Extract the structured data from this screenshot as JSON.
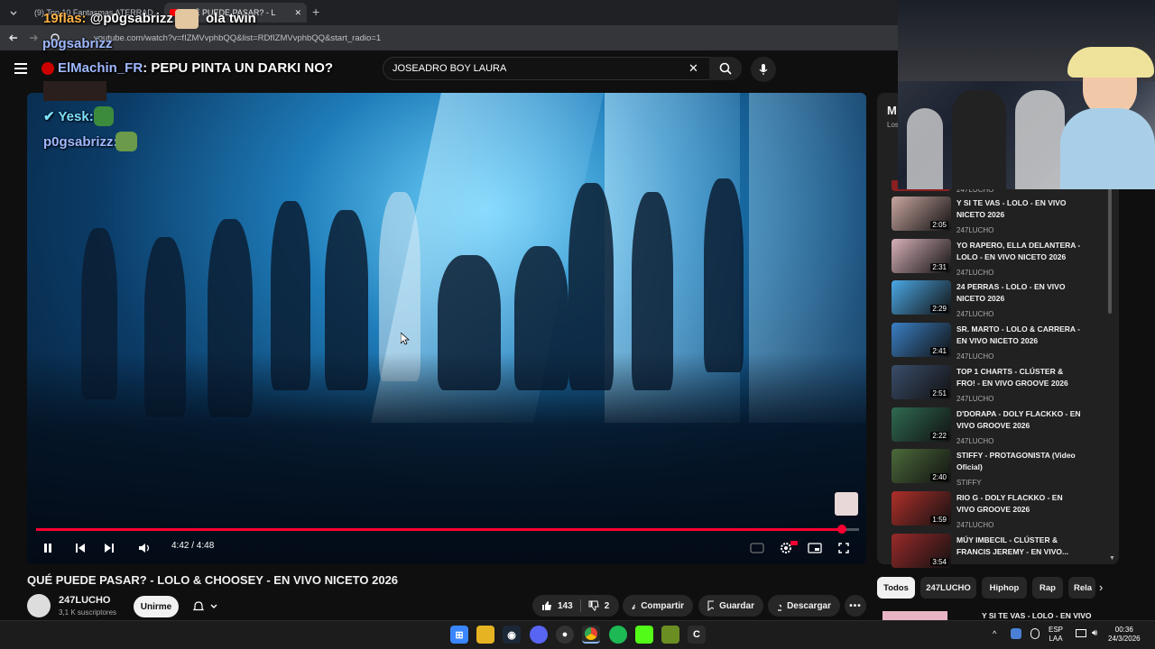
{
  "browser": {
    "tabs": [
      {
        "label": "(9) Top 10 Fantasmas ATERRAD..."
      },
      {
        "label": "QUÉ PUEDE PASAR? - L"
      }
    ],
    "new_tab": "+",
    "url": "youtube.com/watch?v=fIZMVvphbQQ&list=RDfIZMVvphbQQ&start_radio=1"
  },
  "stream_chat": [
    {
      "user": "19flas",
      "message": "@p0gsabrizz",
      "color": "#ffb347"
    },
    {
      "user": "ola twin",
      "message": "",
      "color": "#ffffff"
    },
    {
      "user": "p0gsabrizz",
      "message": "",
      "color": "#9fb8ff"
    },
    {
      "user": "ElMachin_FR",
      "message": "PEPU PINTA UN DARKI NO?",
      "color": "#9fb8ff"
    },
    {
      "user": "Yesk",
      "message": "",
      "color": "#7ee0ff"
    },
    {
      "user": "p0gsabrizz",
      "message": "",
      "color": "#9fb8ff"
    }
  ],
  "search": {
    "value": "JOSEADRO BOY LAURA"
  },
  "player": {
    "time": "4:42 / 4:48",
    "progress": 0.979,
    "accent": "#ff0033"
  },
  "video": {
    "title": "QUÉ PUEDE PASAR? - LOLO & CHOOSEY - EN VIVO NICETO 2026",
    "channel": "247LUCHO",
    "subscribers": "3,1 K suscriptores",
    "subscribe": "Unirme",
    "likes": "143",
    "dislikes": "2",
    "share": "Compartir",
    "save": "Guardar",
    "download": "Descargar"
  },
  "sidebar": {
    "header_letter": "M",
    "header_sub": "Los",
    "top_channel": "247LUCHO",
    "items": [
      {
        "title": "Y SI TE VAS - LOLO - EN VIVO NICETO 2026",
        "channel": "247LUCHO",
        "duration": "2:05",
        "color": "#c9a6a0"
      },
      {
        "title": "YO RAPERO, ELLA DELANTERA - LOLO - EN VIVO NICETO 2026",
        "channel": "247LUCHO",
        "duration": "2:31",
        "color": "#d6b0b8"
      },
      {
        "title": "24 PERRAS - LOLO - EN VIVO NICETO 2026",
        "channel": "247LUCHO",
        "duration": "2:29",
        "color": "#4ba8e6"
      },
      {
        "title": "SR. MARTO - LOLO & CARRERA - EN VIVO NICETO 2026",
        "channel": "247LUCHO",
        "duration": "2:41",
        "color": "#3b7fc4"
      },
      {
        "title": "TOP 1 CHARTS - CLÚSTER & FRO! - EN VIVO GROOVE 2026",
        "channel": "247LUCHO",
        "duration": "2:51",
        "color": "#3a4d6a"
      },
      {
        "title": "D'DORAPA - DOLY FLACKKO - EN VIVO GROOVE 2026",
        "channel": "247LUCHO",
        "duration": "2:22",
        "color": "#2f6a52"
      },
      {
        "title": "STIFFY - PROTAGONISTA (Video Oficial)",
        "channel": "STIFFY",
        "duration": "2:40",
        "color": "#4c6a3a"
      },
      {
        "title": "RIO G - DOLY FLACKKO - EN VIVO GROOVE 2026",
        "channel": "247LUCHO",
        "duration": "1:59",
        "color": "#b0302a"
      },
      {
        "title": "MÚY IMBECIL - CLÚSTER & FRANCIS JEREMY - EN VIVO...",
        "channel": "",
        "duration": "3:54",
        "color": "#9a2a2a"
      }
    ],
    "chips": [
      "Todos",
      "247LUCHO",
      "Hiphop",
      "Rap",
      "Rela"
    ],
    "bottom_item": "Y SI TE VAS - LOLO - EN VIVO"
  },
  "taskbar": {
    "lang": "ESP",
    "layout": "LAA",
    "time": "00:36",
    "date": "24/3/2026"
  },
  "icons": [
    "menu-icon",
    "search-icon",
    "mic-icon",
    "close-icon",
    "pause-icon",
    "prev-icon",
    "next-icon",
    "volume-icon",
    "settings-icon",
    "fullscreen-icon",
    "like-icon",
    "dislike-icon",
    "share-icon",
    "save-icon",
    "download-icon",
    "bell-icon",
    "more-icon"
  ]
}
